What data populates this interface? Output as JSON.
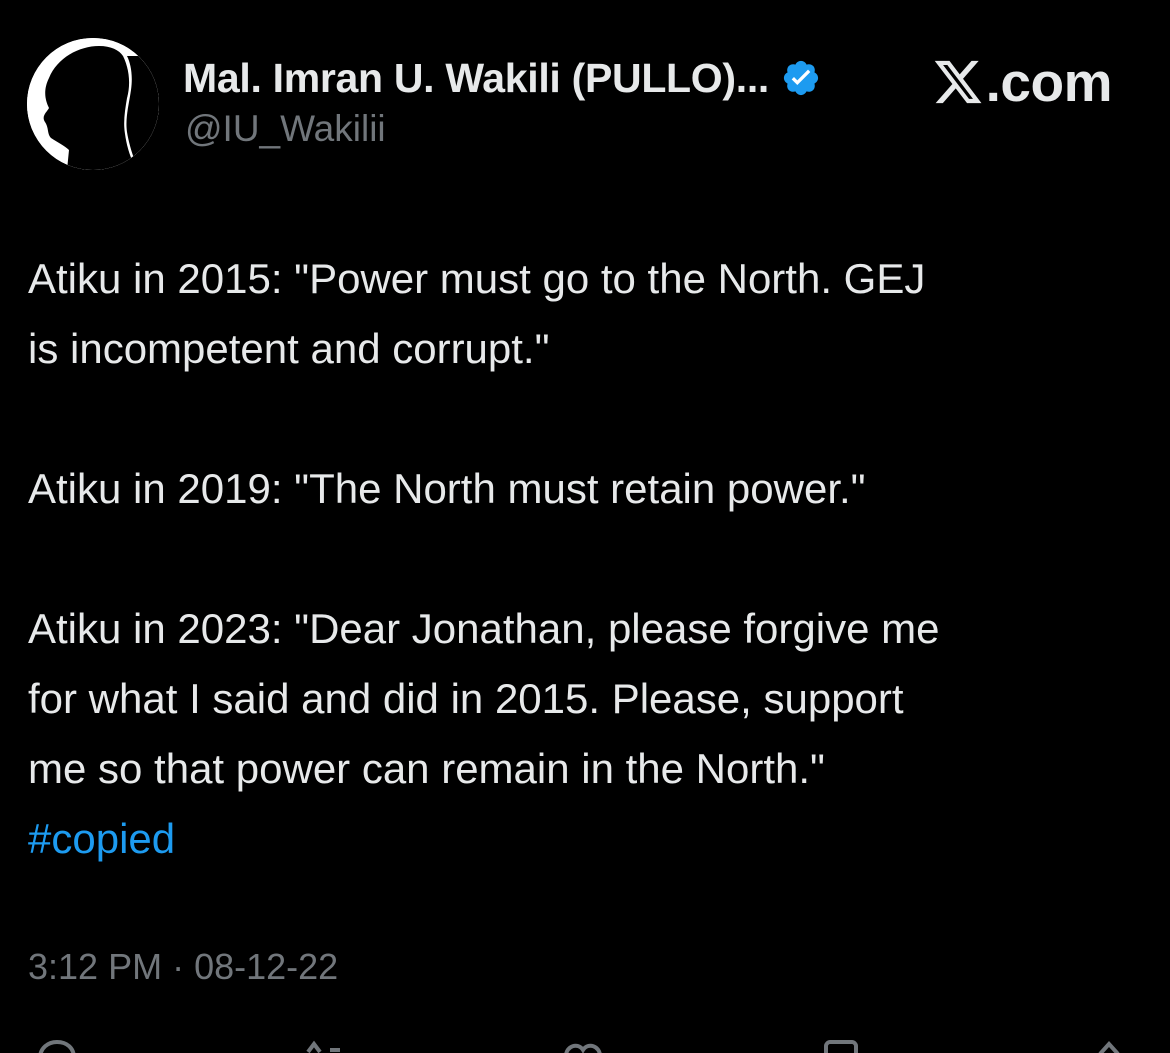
{
  "post": {
    "author": {
      "display_name": "Mal. Imran U. Wakili (PULLO)...",
      "handle": "@IU_Wakilii",
      "verified_icon": "verified-badge-icon",
      "avatar_icon": "silhouette-profile-icon"
    },
    "watermark": {
      "text": ".com",
      "logo_icon": "x-logo-icon"
    },
    "body": {
      "paragraphs": [
        "Atiku in 2015: \"Power must go to the North. GEJ\nis incompetent and corrupt.\"",
        "Atiku in 2019: \"The North must retain power.\"",
        "Atiku in 2023: \"Dear Jonathan, please forgive me\nfor what I said and did in 2015. Please, support\nme so that power can remain in the North.\""
      ],
      "hashtag": "#copied"
    },
    "meta": {
      "time": "3:12 PM",
      "separator": "·",
      "date": "08-12-22"
    },
    "actions": [
      {
        "name": "reply",
        "icon": "reply-icon"
      },
      {
        "name": "repost",
        "icon": "repost-icon"
      },
      {
        "name": "like",
        "icon": "heart-icon"
      },
      {
        "name": "bookmark",
        "icon": "bookmark-icon"
      },
      {
        "name": "share",
        "icon": "share-icon"
      }
    ]
  },
  "colors": {
    "background": "#000000",
    "text_primary": "#e7e9ea",
    "text_secondary": "#71767b",
    "accent": "#1d9bf0"
  }
}
